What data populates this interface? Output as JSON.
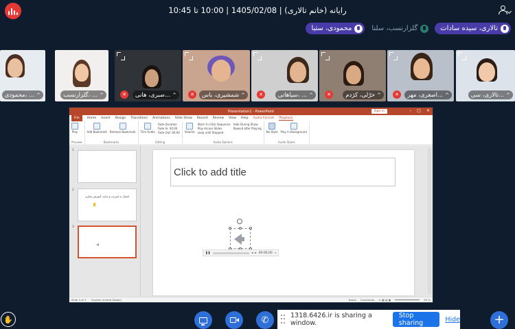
{
  "header": {
    "title": "رایانه (خانم تالاری) | 1405/02/08 | 10:00 تا 10:45"
  },
  "talkers": [
    {
      "name": "تالاری، سیده سادات",
      "active": true
    },
    {
      "name": "گلزارنسب، سلنا",
      "active": false
    },
    {
      "name": "محمودی، ستبا",
      "active": true
    }
  ],
  "videos": [
    {
      "label": "تالاری، سی...",
      "bg": "#dce3ea",
      "skin": "#f0c9aa",
      "hair": "#2b1d16",
      "mic_off": false
    },
    {
      "label": "اصغری، مهر...",
      "bg": "#b9c0c9",
      "skin": "#e8b993",
      "hair": "#3a2418",
      "mic_off": true
    },
    {
      "label": "خرّلی، کژدم",
      "bg": "#8f7f73",
      "skin": "#d9a982",
      "hair": "#2a1a12",
      "mic_off": true
    },
    {
      "label": "سیاهاتی، ...",
      "bg": "#cfcfcf",
      "skin": "#e2b48f",
      "hair": "#3b271b",
      "mic_off": true
    },
    {
      "label": "شمشیری، یاس",
      "bg": "#c9a58f",
      "skin": "#e4b590",
      "hair": "#6f57b8",
      "mic_off": true
    },
    {
      "label": "صبری، هانی...",
      "bg": "#303438",
      "skin": "#caa07e",
      "hair": "#1a1411",
      "mic_off": true
    },
    {
      "label": "گلزارنسب، ...",
      "bg": "#f2f0ee",
      "skin": "#f1c7a5",
      "hair": "#5a3a26",
      "mic_off": false
    },
    {
      "label": "محمودی، ...",
      "bg": "#e7ecf1",
      "skin": "#e9c0a0",
      "hair": "#4b2f20",
      "mic_off": false
    }
  ],
  "presentation": {
    "window_title": "Presentation1 - PowerPoint",
    "signin_label": "Sign in",
    "tabs": [
      "File",
      "Home",
      "Insert",
      "Design",
      "Transitions",
      "Animations",
      "Slide Show",
      "Record",
      "Review",
      "View",
      "Help",
      "Audio Format",
      "Playback"
    ],
    "selected_tab": "Playback",
    "ribbon": {
      "preview": "Play",
      "preview_group": "Preview",
      "bookmark_add": "Add Bookmark",
      "bookmark_remove": "Remove Bookmark",
      "bookmarks_group": "Bookmarks",
      "trim": "Trim Audio",
      "fade_duration": "Fade Duration",
      "fade_in": "Fade In:",
      "fade_out": "Fade Out:",
      "fade_value": "00.00",
      "editing_group": "Editing",
      "volume": "Volume",
      "start": "Start: In Click Sequence",
      "play_across": "Play Across Slides",
      "loop": "Loop until Stopped",
      "hide_show": "Hide During Show",
      "rewind": "Rewind after Playing",
      "audio_options_group": "Audio Options",
      "no_style": "No Style",
      "play_bg": "Play in Background",
      "audio_styles_group": "Audio Styles"
    },
    "thumbnails": [
      {
        "num": "1",
        "text": ""
      },
      {
        "num": "2",
        "text": "اتصال به اینترنت و سایت آموزش مجازی"
      },
      {
        "num": "3",
        "text": ""
      }
    ],
    "slide_title_placeholder": "Click to add title",
    "player_time": "00:00.00",
    "status_left": "Slide 3 of 3",
    "status_lang": "English (United States)",
    "status_notes": "Notes",
    "status_comments": "Comments",
    "status_zoom": "55 %"
  },
  "controls": {
    "raise_hand_icon": "hand-icon",
    "screen_share_icon": "monitor-icon",
    "camera_icon": "camera-icon",
    "phone_icon": "phone-icon",
    "add_icon": "plus-icon"
  },
  "share_banner": {
    "message": "1318.6426.ir is sharing a window.",
    "stop_label": "Stop sharing",
    "hide_label": "Hide"
  },
  "colors": {
    "background": "#0f1c2e",
    "accent_blue": "#2e6fd8",
    "talker_active": "#4a3ca8",
    "mic_off_red": "#e53935",
    "powerpoint_red": "#b7472a"
  }
}
